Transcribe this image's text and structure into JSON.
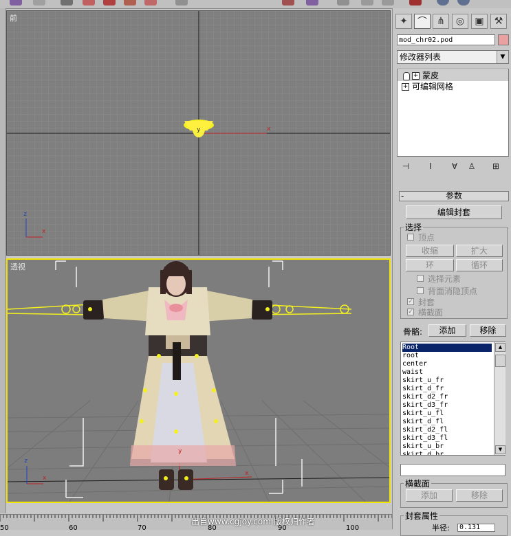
{
  "viewports": {
    "front_label": "前",
    "persp_label": "透视"
  },
  "gizmo": {
    "x": "x",
    "y": "y",
    "z": "z"
  },
  "panel": {
    "object_name": "mod_chr02.pod",
    "object_color": "#e8a0a0",
    "modifier_list": "修改器列表",
    "stack": [
      {
        "label": "蒙皮",
        "selected": true
      },
      {
        "label": "可编辑网格",
        "selected": false
      }
    ],
    "rollout_title": "参数",
    "rollout_minus": "-",
    "edit_envelope": "编辑封套",
    "select_group": "选择",
    "vertex": "顶点",
    "shrink": "收缩",
    "grow": "扩大",
    "ring": "环",
    "loop": "循环",
    "select_element": "选择元素",
    "backface_cull": "背面消隐顶点",
    "envelopes": "封套",
    "cross_sections": "横截面",
    "bones_label": "骨骼:",
    "add": "添加",
    "remove": "移除",
    "bones": [
      "Root",
      "root",
      "center",
      "waist",
      "skirt_u_fr",
      "skirt_d_fr",
      "skirt_d2_fr",
      "skirt_d3_fr",
      "skirt_u_fl",
      "skirt_d_fl",
      "skirt_d2_fl",
      "skirt_d3_fl",
      "skirt_u_br",
      "skirt_d_br"
    ],
    "cross_section_group": "横截面",
    "add2": "添加",
    "remove2": "移除",
    "envelope_props": "封套属性",
    "radius_label": "半径:",
    "radius_value": "0.131"
  },
  "timeline": {
    "ticks": [
      "50",
      "60",
      "70",
      "80",
      "90",
      "100"
    ],
    "watermark": "出自www.cgjoy.com 版权归作者"
  }
}
